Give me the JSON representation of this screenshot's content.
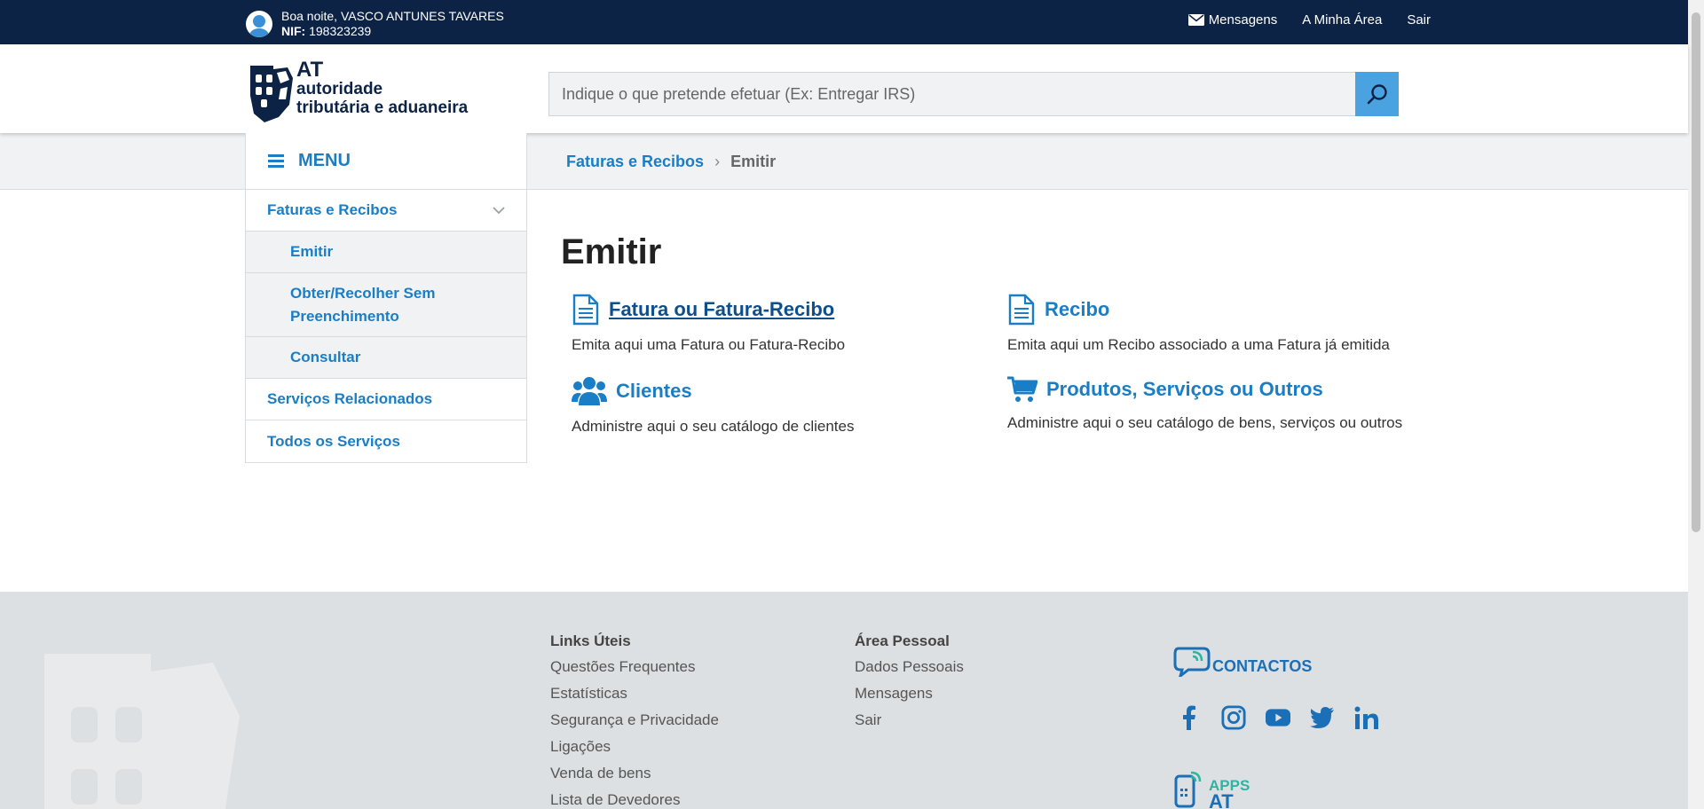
{
  "topbar": {
    "greeting": "Boa noite, VASCO ANTUNES TAVARES",
    "nif_label": "NIF:",
    "nif_value": " 198323239",
    "links": {
      "messages": "Mensagens",
      "my_area": "A Minha Área",
      "logout": "Sair"
    }
  },
  "header": {
    "logo": {
      "line1": "AT",
      "line2": "autoridade",
      "line3": "tributária e aduaneira"
    },
    "search_placeholder": "Indique o que pretende efetuar (Ex: Entregar IRS)"
  },
  "breadcrumb": {
    "parent": "Faturas e Recibos",
    "current": "Emitir"
  },
  "sidebar": {
    "menu_label": "MENU",
    "items": [
      {
        "label": "Faturas e Recibos"
      },
      {
        "label": "Emitir"
      },
      {
        "label": "Obter/Recolher Sem Preenchimento"
      },
      {
        "label": "Consultar"
      },
      {
        "label": "Serviços Relacionados"
      },
      {
        "label": "Todos os Serviços"
      }
    ]
  },
  "main": {
    "title": "Emitir",
    "cards": [
      {
        "title": "Fatura ou Fatura-Recibo",
        "desc": "Emita aqui uma Fatura ou Fatura-Recibo",
        "icon": "document-icon"
      },
      {
        "title": "Recibo",
        "desc": "Emita aqui um Recibo associado a uma Fatura já emitida",
        "icon": "document-icon"
      },
      {
        "title": "Clientes",
        "desc": "Administre aqui o seu catálogo de clientes",
        "icon": "users-icon"
      },
      {
        "title": "Produtos, Serviços ou Outros",
        "desc": "Administre aqui o seu catálogo de bens, serviços ou outros",
        "icon": "cart-icon"
      }
    ]
  },
  "footer": {
    "links_title": "Links Úteis",
    "links": [
      "Questões Frequentes",
      "Estatísticas",
      "Segurança e Privacidade",
      "Ligações",
      "Venda de bens",
      "Lista de Devedores"
    ],
    "personal_title": "Área Pessoal",
    "personal": [
      "Dados Pessoais",
      "Mensagens",
      "Sair"
    ],
    "contacts_label": "CONTACTOS",
    "apps_line1": "APPS",
    "apps_line2": "AT"
  },
  "colors": {
    "navy": "#0d2346",
    "link_blue": "#1a7ec6",
    "search_button": "#4aa3e0",
    "footer_bg": "#dde0e3"
  }
}
